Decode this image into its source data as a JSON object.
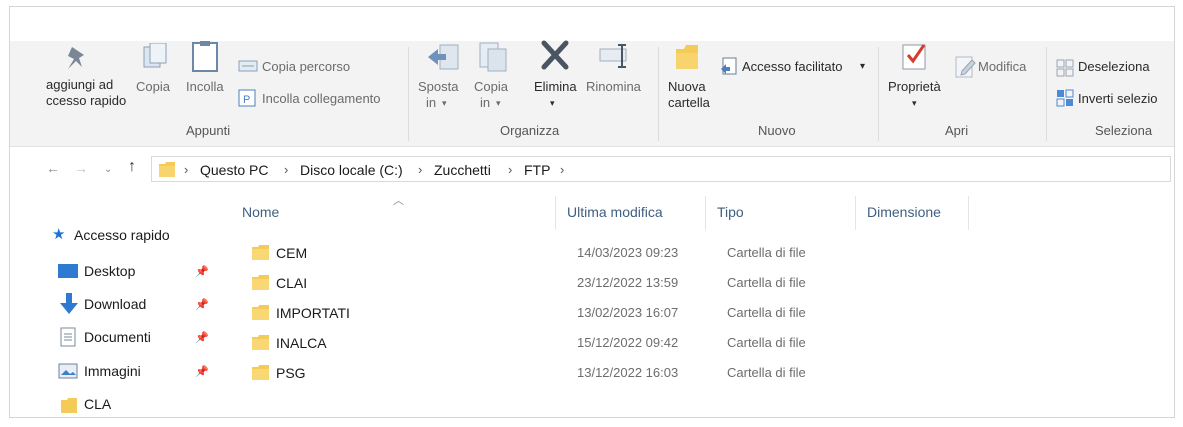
{
  "ribbon": {
    "groups": {
      "appunti": {
        "label": "Appunti",
        "pin_label": [
          "aggiungi ad",
          "ccesso rapido"
        ],
        "copy_label": "Copia",
        "paste_label": "Incolla",
        "copy_path_label": "Copia percorso",
        "paste_link_label": "Incolla collegamento"
      },
      "organizza": {
        "label": "Organizza",
        "move_label": [
          "Sposta",
          "in"
        ],
        "copy_to_label": [
          "Copia",
          "in"
        ],
        "delete_label": "Elimina",
        "rename_label": "Rinomina"
      },
      "nuovo": {
        "label": "Nuovo",
        "new_folder_label": [
          "Nuova",
          "cartella"
        ],
        "easy_access_label": "Accesso facilitato"
      },
      "apri": {
        "label": "Apri",
        "properties_label": "Proprietà",
        "edit_label": "Modifica"
      },
      "seleziona": {
        "label": "Seleziona",
        "deselect_label": "Deseleziona",
        "invert_label": "Inverti selezio"
      }
    }
  },
  "address": {
    "breadcrumb": [
      "Questo PC",
      "Disco locale (C:)",
      "Zucchetti",
      "FTP"
    ]
  },
  "navpane": {
    "quick_access": "Accesso rapido",
    "items": [
      {
        "label": "Desktop",
        "icon": "desktop-icon"
      },
      {
        "label": "Download",
        "icon": "download-arrow-icon"
      },
      {
        "label": "Documenti",
        "icon": "document-icon"
      },
      {
        "label": "Immagini",
        "icon": "image-icon"
      },
      {
        "label": "CLA",
        "icon": "folder-icon"
      }
    ]
  },
  "filelist": {
    "columns": [
      "Nome",
      "Ultima modifica",
      "Tipo",
      "Dimensione"
    ],
    "rows": [
      {
        "name": "CEM",
        "modified": "14/03/2023 09:23",
        "type": "Cartella di file"
      },
      {
        "name": "CLAI",
        "modified": "23/12/2022 13:59",
        "type": "Cartella di file"
      },
      {
        "name": "IMPORTATI",
        "modified": "13/02/2023 16:07",
        "type": "Cartella di file"
      },
      {
        "name": "INALCA",
        "modified": "15/12/2022 09:42",
        "type": "Cartella di file"
      },
      {
        "name": "PSG",
        "modified": "13/12/2022 16:03",
        "type": "Cartella di file"
      }
    ]
  },
  "colors": {
    "accent": "#1e73d6",
    "folder": "#f5cb57",
    "folder_dark": "#e0ae36",
    "header_text": "#3f5f80"
  }
}
